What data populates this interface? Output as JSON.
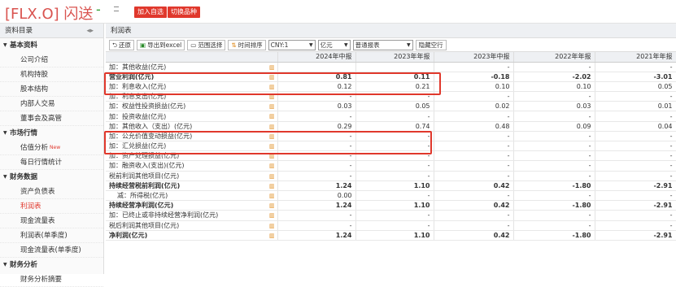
{
  "header": {
    "stock": "[FLX.O] 闪送",
    "change": "-",
    "add_watchlist": "加入自选",
    "switch_product": "切换品种"
  },
  "sidebar": {
    "title": "资料目录",
    "groups": [
      {
        "label": "基本资料",
        "items": [
          {
            "label": "公司介绍"
          },
          {
            "label": "机构持股"
          },
          {
            "label": "股本结构"
          },
          {
            "label": "内部人交易"
          },
          {
            "label": "董事会及高管"
          }
        ]
      },
      {
        "label": "市场行情",
        "items": [
          {
            "label": "估值分析",
            "badge": "New"
          },
          {
            "label": "每日行情统计"
          }
        ]
      },
      {
        "label": "财务数据",
        "items": [
          {
            "label": "资产负债表"
          },
          {
            "label": "利润表",
            "active": true
          },
          {
            "label": "现金流量表"
          },
          {
            "label": "利润表(单季度)"
          },
          {
            "label": "现金流量表(单季度)"
          }
        ]
      },
      {
        "label": "财务分析",
        "items": [
          {
            "label": "财务分析摘要"
          }
        ]
      }
    ]
  },
  "main": {
    "tab": "利润表",
    "toolbar": {
      "restore": "还原",
      "export": "导出到excel",
      "range": "范围选择",
      "sort": "时间排序",
      "currency": "CNY:1",
      "unit": "亿元",
      "report": "普通报表",
      "hide_empty": "隐藏空行"
    },
    "columns": [
      "2024年中报",
      "2023年年报",
      "2023年中报",
      "2022年年报",
      "2021年年报"
    ],
    "rows": [
      {
        "name": "加：其他收益(亿元)",
        "values": [
          "",
          "",
          "-",
          "-",
          "-"
        ],
        "style": "cut"
      },
      {
        "name": "营业利润(亿元)",
        "values": [
          "0.81",
          "0.11",
          "-0.18",
          "-2.02",
          "-3.01"
        ],
        "bold": true
      },
      {
        "name": "加：利息收入(亿元)",
        "values": [
          "0.12",
          "0.21",
          "0.10",
          "0.10",
          "0.05"
        ]
      },
      {
        "name": "加：利息支出(亿元)",
        "values": [
          "-",
          "-",
          "-",
          "-",
          "-"
        ]
      },
      {
        "name": "加：权益性投资损益(亿元)",
        "values": [
          "0.03",
          "0.05",
          "0.02",
          "0.03",
          "0.01"
        ]
      },
      {
        "name": "加：投资收益(亿元)",
        "values": [
          "-",
          "-",
          "-",
          "-",
          "-"
        ]
      },
      {
        "name": "加：其他收入（支出）(亿元)",
        "values": [
          "0.29",
          "0.74",
          "0.48",
          "0.09",
          "0.04"
        ]
      },
      {
        "name": "加：公允价值变动损益(亿元)",
        "values": [
          "-",
          "-",
          "-",
          "-",
          "-"
        ]
      },
      {
        "name": "加：汇兑损益(亿元)",
        "values": [
          "-",
          "-",
          "-",
          "-",
          "-"
        ]
      },
      {
        "name": "加：资产处理损益(亿元)",
        "values": [
          "-",
          "-",
          "-",
          "-",
          "-"
        ]
      },
      {
        "name": "加：融资收入(支出)(亿元)",
        "values": [
          "-",
          "-",
          "-",
          "-",
          "-"
        ]
      },
      {
        "name": "税前利润其他项目(亿元)",
        "values": [
          "-",
          "-",
          "-",
          "-",
          "-"
        ]
      },
      {
        "name": "持续经营税前利润(亿元)",
        "values": [
          "1.24",
          "1.10",
          "0.42",
          "-1.80",
          "-2.91"
        ],
        "bold": true
      },
      {
        "name": "减：所得税(亿元)",
        "values": [
          "0.00",
          "-",
          "-",
          "-",
          "-"
        ],
        "sub": true
      },
      {
        "name": "持续经营净利润(亿元)",
        "values": [
          "1.24",
          "1.10",
          "0.42",
          "-1.80",
          "-2.91"
        ],
        "bold": true
      },
      {
        "name": "加：已终止或非持续经营净利润(亿元)",
        "values": [
          "-",
          "-",
          "-",
          "-",
          "-"
        ]
      },
      {
        "name": "税后利润其他项目(亿元)",
        "values": [
          "-",
          "-",
          "-",
          "-",
          "-"
        ]
      },
      {
        "name": "净利润(亿元)",
        "values": [
          "1.24",
          "1.10",
          "0.42",
          "-1.80",
          "-2.91"
        ],
        "bold": true
      }
    ]
  },
  "colors": {
    "accent": "#e0382c",
    "chart_icon": "#e08a1a"
  }
}
